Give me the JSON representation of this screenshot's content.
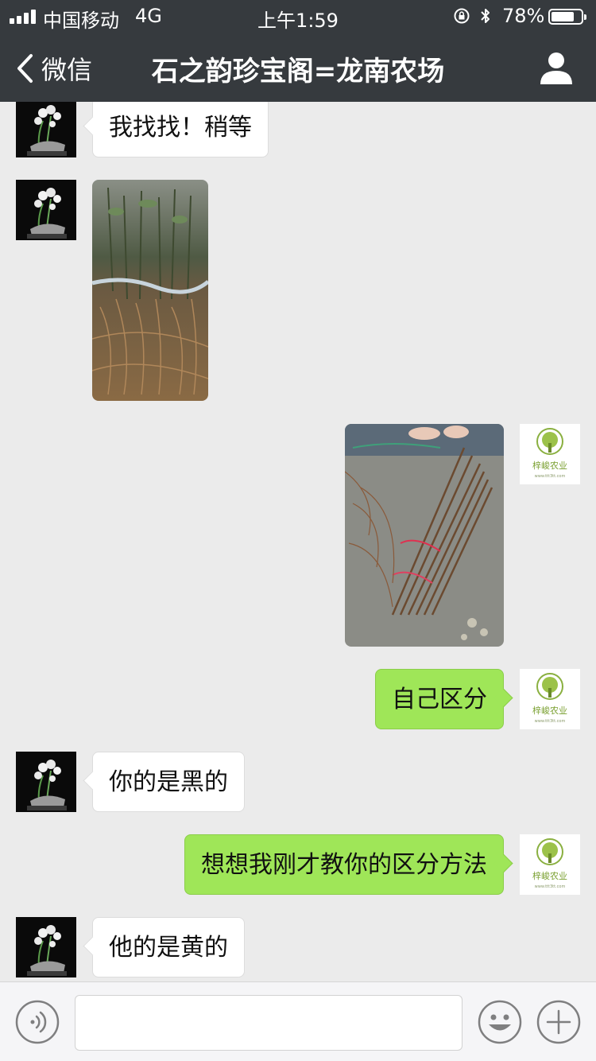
{
  "status_bar": {
    "carrier": "中国移动",
    "network": "4G",
    "time": "上午1:59",
    "battery_percent": "78%",
    "battery_level": 0.78,
    "signal_bars": 4
  },
  "nav": {
    "back_label": "微信",
    "title": "石之韵珍宝阁=龙南农场"
  },
  "messages": [
    {
      "from": "other",
      "type": "text",
      "text": "我找找！稍等"
    },
    {
      "from": "other",
      "type": "image",
      "image": "photo of bundled plant seedlings with roots"
    },
    {
      "from": "me",
      "type": "image",
      "image": "photo of bundled seedlings tied with colored string"
    },
    {
      "from": "me",
      "type": "text",
      "text": "自己区分"
    },
    {
      "from": "other",
      "type": "text",
      "text": "你的是黑的"
    },
    {
      "from": "me",
      "type": "text",
      "text": "想想我刚才教你的区分方法"
    },
    {
      "from": "other",
      "type": "text",
      "text": "他的是黄的"
    }
  ],
  "avatars": {
    "me_logo_text": "梓峻农业",
    "me_logo_url_text": "www.ttt3tt.com"
  },
  "input_bar": {
    "voice_icon": "voice-icon",
    "emoji_icon": "emoji-icon",
    "plus_icon": "plus-icon",
    "value": ""
  },
  "colors": {
    "nav_bg": "#363a3e",
    "chat_bg": "#ebebeb",
    "outgoing_bubble": "#9fe658",
    "incoming_bubble": "#ffffff"
  }
}
